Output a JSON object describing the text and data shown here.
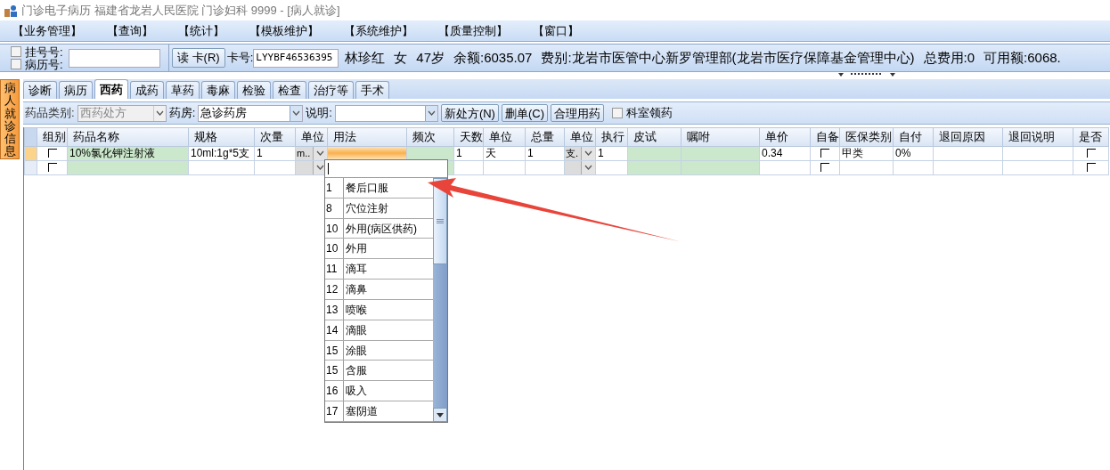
{
  "window": {
    "title": "门诊电子病历  福建省龙岩人民医院  门诊妇科  9999 - [病人就诊]"
  },
  "menu": [
    "【业务管理】",
    "【查询】",
    "【统计】",
    "【模板维护】",
    "【系统维护】",
    "【质量控制】",
    "【窗口】"
  ],
  "patient_bar": {
    "checkboxes": [
      {
        "label": "挂号号:",
        "checked": false
      },
      {
        "label": "病历号:",
        "checked": false
      }
    ],
    "read_card_button": "读 卡(R)",
    "card_label": "卡号:",
    "card_value": "LYYBF46536395",
    "info": [
      "林珍红",
      "女",
      "47岁",
      "余额:6035.07",
      "费别:龙岩市医管中心新罗管理部(龙岩市医疗保障基金管理中心)",
      "总费用:0",
      "可用额:6068."
    ]
  },
  "side_tab": {
    "label": "病人就诊信息"
  },
  "tabs": [
    {
      "label": "诊断",
      "selected": false
    },
    {
      "label": "病历",
      "selected": false
    },
    {
      "label": "西药",
      "selected": true
    },
    {
      "label": "成药",
      "selected": false
    },
    {
      "label": "草药",
      "selected": false
    },
    {
      "label": "毒麻",
      "selected": false
    },
    {
      "label": "检验",
      "selected": false
    },
    {
      "label": "检查",
      "selected": false
    },
    {
      "label": "治疗等",
      "selected": false
    },
    {
      "label": "手术",
      "selected": false
    }
  ],
  "toolbar": {
    "category_label": "药品类别:",
    "category_value": "西药处方",
    "category_disabled": true,
    "pharmacy_label": "药房:",
    "pharmacy_value": "急诊药房",
    "note_label": "说明:",
    "buttons": [
      "新处方(N)",
      "删单(C)",
      "合理用药"
    ],
    "dept_checkbox": {
      "label": "科室领药",
      "checked": false
    }
  },
  "grid": {
    "columns": [
      {
        "label": "组别",
        "kind": "check"
      },
      {
        "label": "药品名称",
        "kind": "entry"
      },
      {
        "label": "规格",
        "kind": "text"
      },
      {
        "label": "次量",
        "kind": "text"
      },
      {
        "label": "单位",
        "kind": "combo"
      },
      {
        "label": "用法",
        "kind": "text"
      },
      {
        "label": "频次",
        "kind": "entry"
      },
      {
        "label": "天数",
        "kind": "text"
      },
      {
        "label": "单位",
        "kind": "text"
      },
      {
        "label": "总量",
        "kind": "text"
      },
      {
        "label": "单位",
        "kind": "combo"
      },
      {
        "label": "执行",
        "kind": "text"
      },
      {
        "label": "皮试",
        "kind": "entry"
      },
      {
        "label": "嘱咐",
        "kind": "entry"
      },
      {
        "label": "单价",
        "kind": "text"
      },
      {
        "label": "自备",
        "kind": "check"
      },
      {
        "label": "医保类别",
        "kind": "text"
      },
      {
        "label": "自付",
        "kind": "text"
      },
      {
        "label": "退回原因",
        "kind": "text"
      },
      {
        "label": "退回说明",
        "kind": "text"
      },
      {
        "label": "是否",
        "kind": "check"
      }
    ],
    "rows": [
      {
        "selected": true,
        "cells": [
          {
            "checked": false
          },
          {
            "value": "10%氯化钾注射液"
          },
          {
            "value": "10ml:1g*5支"
          },
          {
            "value": "1"
          },
          {
            "value": "m.."
          },
          {
            "focused": true
          },
          {},
          {
            "value": "1"
          },
          {
            "value": "天"
          },
          {
            "value": "1"
          },
          {
            "value": "支."
          },
          {
            "value": "1"
          },
          {},
          {},
          {
            "value": "0.34"
          },
          {
            "checked": false
          },
          {
            "value": "甲类"
          },
          {
            "value": "0%"
          },
          {},
          {},
          {
            "checked": false
          }
        ]
      },
      {
        "selected": false,
        "cells": [
          {
            "checked": false
          },
          {},
          {},
          {},
          {},
          {},
          {},
          {},
          {},
          {},
          {},
          {},
          {},
          {},
          {},
          {
            "checked": false
          },
          {},
          {},
          {},
          {},
          {
            "checked": false
          }
        ]
      }
    ]
  },
  "usage_dropdown": {
    "items": [
      {
        "code": "1",
        "label": "餐后口服"
      },
      {
        "code": "8",
        "label": "穴位注射"
      },
      {
        "code": "10",
        "label": "外用(病区供药)"
      },
      {
        "code": "10",
        "label": "外用"
      },
      {
        "code": "11",
        "label": "滴耳"
      },
      {
        "code": "12",
        "label": "滴鼻"
      },
      {
        "code": "13",
        "label": "喷喉"
      },
      {
        "code": "14",
        "label": "滴眼"
      },
      {
        "code": "15",
        "label": "涂眼"
      },
      {
        "code": "15",
        "label": "含服"
      },
      {
        "code": "16",
        "label": "吸入"
      },
      {
        "code": "17",
        "label": "塞阴道"
      }
    ]
  }
}
